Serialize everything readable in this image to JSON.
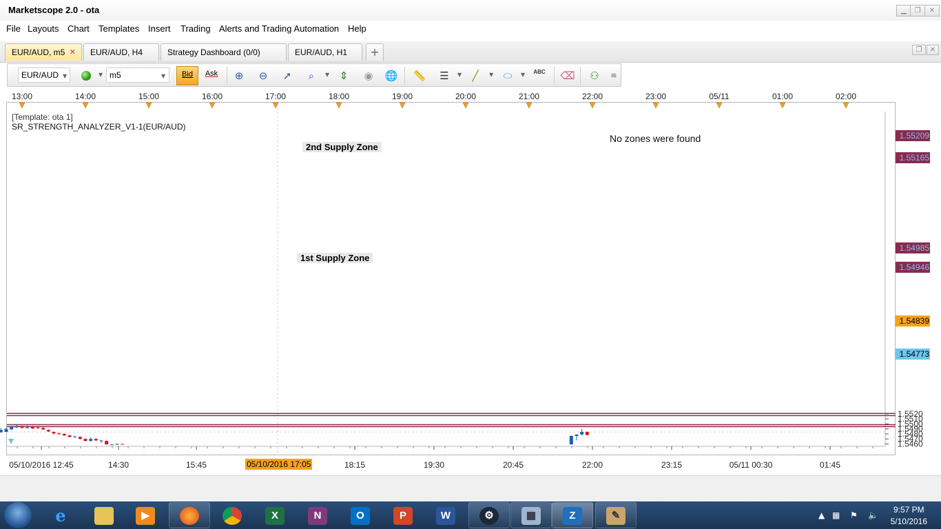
{
  "window": {
    "title": "Marketscope 2.0 - ota"
  },
  "menu": [
    "File",
    "Layouts",
    "Chart",
    "Templates",
    "Insert",
    "Trading",
    "Alerts and Trading Automation",
    "Help"
  ],
  "tabs": [
    {
      "label": "EUR/AUD, m5",
      "active": true
    },
    {
      "label": "EUR/AUD, H4",
      "active": false
    },
    {
      "label": "Strategy Dashboard (0/0)",
      "active": false
    },
    {
      "label": "EUR/AUD, H1",
      "active": false
    }
  ],
  "toolbar": {
    "instrument": "EUR/AUD",
    "timeframe": "m5",
    "bid_label": "Bid",
    "ask_label": "Ask",
    "abc_label": "ABC"
  },
  "chart": {
    "template_label": "[Template: ota 1]",
    "indicator_label": "SR_STRENGTH_ANALYZER_V1-1(EUR/AUD)",
    "no_zones_text": "No zones were found",
    "zones": [
      {
        "label": "2nd Supply Zone",
        "top": 1.55209,
        "bottom": 1.55165,
        "top_text": "1.55209",
        "bottom_text": "1.55165"
      },
      {
        "label": "1st Supply Zone",
        "top": 1.54985,
        "bottom": 1.54946,
        "top_text": "1.54985",
        "bottom_text": "1.54946"
      }
    ],
    "current_price": "1.54839",
    "ask_price": "1.54773",
    "crosshair_time": "05/10/2016 17:05",
    "top_time_labels": [
      "13:00",
      "14:00",
      "15:00",
      "16:00",
      "17:00",
      "18:00",
      "19:00",
      "20:00",
      "21:00",
      "22:00",
      "23:00",
      "05/11",
      "01:00",
      "02:00"
    ],
    "bottom_time_labels": [
      "05/10/2016 12:45",
      "14:30",
      "15:45",
      "18:15",
      "19:30",
      "20:45",
      "22:00",
      "23:15",
      "05/11 00:30",
      "01:45"
    ],
    "colors": {
      "up": "#1f5fb3",
      "down": "#d11a1a",
      "zone_line": "#8b2a4f",
      "current": "#f7a21b",
      "ask": "#6ec6ee"
    }
  },
  "chart_data": {
    "type": "candlestick",
    "xlabel": "",
    "ylabel": "",
    "ylim": [
      1.5459,
      1.5525
    ],
    "y_ticks": [
      "1.5460",
      "1.5470",
      "1.5480",
      "1.5490",
      "1.5500",
      "1.5510",
      "1.5520"
    ],
    "candles": [
      {
        "time": "12:40",
        "open": 1.5483,
        "high": 1.5492,
        "low": 1.5483,
        "close": 1.5488
      },
      {
        "time": "12:45",
        "open": 1.5484,
        "high": 1.5493,
        "low": 1.5484,
        "close": 1.549
      },
      {
        "time": "12:50",
        "open": 1.5489,
        "high": 1.5496,
        "low": 1.5488,
        "close": 1.5495
      },
      {
        "time": "12:55",
        "open": 1.5493,
        "high": 1.5498,
        "low": 1.5492,
        "close": 1.5496
      },
      {
        "time": "13:00",
        "open": 1.5496,
        "high": 1.5496,
        "low": 1.5491,
        "close": 1.5492
      },
      {
        "time": "13:05",
        "open": 1.5492,
        "high": 1.5497,
        "low": 1.5491,
        "close": 1.5493
      },
      {
        "time": "13:10",
        "open": 1.5494,
        "high": 1.5496,
        "low": 1.549,
        "close": 1.5491
      },
      {
        "time": "13:15",
        "open": 1.5493,
        "high": 1.5494,
        "low": 1.549,
        "close": 1.5492
      },
      {
        "time": "13:20",
        "open": 1.5492,
        "high": 1.5493,
        "low": 1.5488,
        "close": 1.5489
      },
      {
        "time": "13:25",
        "open": 1.5488,
        "high": 1.5489,
        "low": 1.5484,
        "close": 1.5485
      },
      {
        "time": "13:30",
        "open": 1.5484,
        "high": 1.5485,
        "low": 1.5479,
        "close": 1.5481
      },
      {
        "time": "13:35",
        "open": 1.5481,
        "high": 1.5483,
        "low": 1.5478,
        "close": 1.548
      },
      {
        "time": "13:40",
        "open": 1.548,
        "high": 1.5481,
        "low": 1.5476,
        "close": 1.5477
      },
      {
        "time": "13:45",
        "open": 1.5477,
        "high": 1.5478,
        "low": 1.5473,
        "close": 1.5474
      },
      {
        "time": "13:50",
        "open": 1.5474,
        "high": 1.5476,
        "low": 1.5472,
        "close": 1.5475
      },
      {
        "time": "13:55",
        "open": 1.5474,
        "high": 1.5475,
        "low": 1.5469,
        "close": 1.547
      },
      {
        "time": "14:00",
        "open": 1.547,
        "high": 1.5471,
        "low": 1.5465,
        "close": 1.5466
      },
      {
        "time": "14:05",
        "open": 1.5466,
        "high": 1.5473,
        "low": 1.5465,
        "close": 1.547
      },
      {
        "time": "14:10",
        "open": 1.547,
        "high": 1.5471,
        "low": 1.5466,
        "close": 1.5467
      },
      {
        "time": "14:15",
        "open": 1.5467,
        "high": 1.5468,
        "low": 1.5462,
        "close": 1.5467
      },
      {
        "time": "14:20",
        "open": 1.5466,
        "high": 1.5467,
        "low": 1.5459,
        "close": 1.5459
      },
      {
        "time": "14:25",
        "open": 1.5459,
        "high": 1.546,
        "low": 1.5459,
        "close": 1.5459
      },
      {
        "time": "14:30",
        "open": 1.5459,
        "high": 1.5461,
        "low": 1.5459,
        "close": 1.546
      },
      {
        "time": "14:35",
        "open": 1.546,
        "high": 1.546,
        "low": 1.5459,
        "close": 1.5459
      },
      {
        "time": "21:40",
        "open": 1.5459,
        "high": 1.5477,
        "low": 1.5459,
        "close": 1.5476
      },
      {
        "time": "21:45",
        "open": 1.5476,
        "high": 1.5477,
        "low": 1.5467,
        "close": 1.5479
      },
      {
        "time": "21:50",
        "open": 1.5479,
        "high": 1.549,
        "low": 1.5477,
        "close": 1.5484
      },
      {
        "time": "21:55",
        "open": 1.5484,
        "high": 1.5485,
        "low": 1.5477,
        "close": 1.5478
      }
    ]
  },
  "taskbar": {
    "clock_time": "9:57 PM",
    "clock_date": "5/10/2016"
  }
}
